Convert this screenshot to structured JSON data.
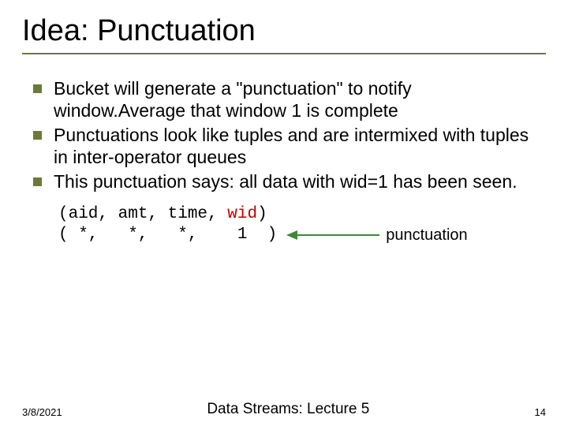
{
  "title": "Idea: Punctuation",
  "bullets": [
    "Bucket will generate a \"punctuation\" to notify window.Average that window 1 is complete",
    "Punctuations look like tuples and are intermixed with tuples in inter-operator queues",
    "This punctuation says: all data with wid=1 has been seen."
  ],
  "code": {
    "header_plain": "(aid, amt, time, ",
    "header_wid": "wid",
    "header_close": ")",
    "row": "( *,   *,   *,    1  )"
  },
  "annotation": "punctuation",
  "footer": {
    "date": "3/8/2021",
    "center": "Data Streams: Lecture 5",
    "page": "14"
  }
}
